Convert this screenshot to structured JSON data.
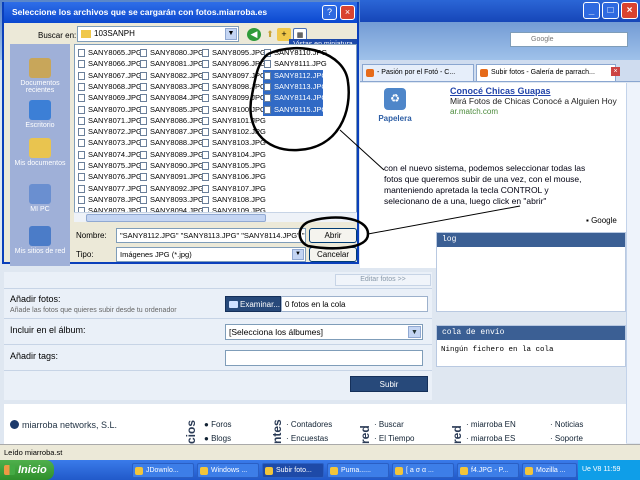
{
  "dialog": {
    "title": "Seleccione los archivos que se cargarán con fotos.miarroba.es",
    "look_in_label": "Buscar en:",
    "folder": "103SANPH",
    "tooltip": "Vistas en miniatura",
    "places": [
      "Documentos recientes",
      "Escritorio",
      "Mis documentos",
      "MI PC",
      "Mis sitios de red"
    ],
    "files_col1": [
      "SANY8065.JPG",
      "SANY8066.JPG",
      "SANY8067.JPG",
      "SANY8068.JPG",
      "SANY8069.JPG",
      "SANY8070.JPG",
      "SANY8071.JPG",
      "SANY8072.JPG",
      "SANY8073.JPG",
      "SANY8074.JPG",
      "SANY8075.JPG",
      "SANY8076.JPG",
      "SANY8077.JPG",
      "SANY8078.JPG",
      "SANY8079.JPG"
    ],
    "files_col2": [
      "SANY8080.JPG",
      "SANY8081.JPG",
      "SANY8082.JPG",
      "SANY8083.JPG",
      "SANY8084.JPG",
      "SANY8085.JPG",
      "SANY8086.JPG",
      "SANY8087.JPG",
      "SANY8088.JPG",
      "SANY8089.JPG",
      "SANY8090.JPG",
      "SANY8091.JPG",
      "SANY8092.JPG",
      "SANY8093.JPG",
      "SANY8094.JPG"
    ],
    "files_col3": [
      "SANY8095.JPG",
      "SANY8096.JPG",
      "SANY8097.JPG",
      "SANY8098.JPG",
      "SANY8099.JPG",
      "SANY8100.JPG",
      "SANY8101.JPG",
      "SANY8102.JPG",
      "SANY8103.JPG",
      "SANY8104.JPG",
      "SANY8105.JPG",
      "SANY8106.JPG",
      "SANY8107.JPG",
      "SANY8108.JPG",
      "SANY8109.JPG"
    ],
    "files_col4": [
      "SANY8110.JPG",
      "SANY8111.JPG",
      "SANY8112.JPG",
      "SANY8113.JPG",
      "SANY8114.JPG",
      "SANY8115.JPG"
    ],
    "selected_files": [
      "SANY8112.JPG",
      "SANY8113.JPG",
      "SANY8114.JPG",
      "SANY8115.JPG"
    ],
    "name_label": "Nombre:",
    "name_value": "\"SANY8112.JPG\" \"SANY8113.JPG\" \"SANY8114.JPG\" \"S",
    "type_label": "Tipo:",
    "type_value": "Imágenes JPG (*.jpg)",
    "open_button": "Abrir",
    "cancel_button": "Cancelar"
  },
  "browser": {
    "search_placeholder": "Google",
    "tabs": [
      "- Pasión por el Fotó - C...",
      "Subir fotos - Galería de parrach..."
    ],
    "papelera_label": "Papelera",
    "ad": {
      "title": "Conocé Chicas Guapas",
      "desc": "Mirá Fotos de Chicas Conocé a Alguien Hoy",
      "url": "ar.match.com"
    },
    "google_brand": "Google",
    "panel_log_title": "log",
    "panel_cola_title": "cola de envío",
    "cola_empty": "Ningún fichero en la cola",
    "status_text": "Leído miarroba.st"
  },
  "form": {
    "editar_fotos": "Editar fotos >>",
    "anadir_label": "Añadir fotos:",
    "anadir_sub": "Añade las fotos que quieres subir desde tu ordenador",
    "examinar_button": "Examinar...",
    "fotos_en_cola": "0 fotos en la cola",
    "album_label": "Incluir en el álbum:",
    "album_select": "[Selecciona los álbumes]",
    "tags_label": "Añadir tags:",
    "subir_button": "Subir"
  },
  "footer": {
    "brand": "miarroba networks, S.L.",
    "vwords": [
      "cios",
      "ntes",
      "red",
      "red"
    ],
    "links": [
      "Foros",
      "Blogs",
      "Contadores",
      "Encuestas",
      "Buscar",
      "El Tiempo",
      "miarroba EN",
      "miarroba ES",
      "Noticias",
      "Soporte"
    ]
  },
  "annotation": {
    "text": "con el nuevo sistema, podemos seleccionar todas las fotos que queremos subir de una vez, con el mouse, manteniendo apretada la tecla CONTROL y selecionano de a una, luego click en \"abrir\""
  },
  "taskbar": {
    "start": "Inicio",
    "buttons": [
      "JDownlo...",
      "Windows ...",
      "Subir foto...",
      "Puma......",
      "[ a  σ  α ...",
      "f4.JPG - P...",
      "Mozilla ..."
    ],
    "tray_lang": "Ue V8",
    "clock": "11:59"
  },
  "colors": {
    "title_blue": "#0b48cf",
    "selection": "#316ac5",
    "panel_header": "#3b5f94",
    "button_dark": "#27497a"
  }
}
